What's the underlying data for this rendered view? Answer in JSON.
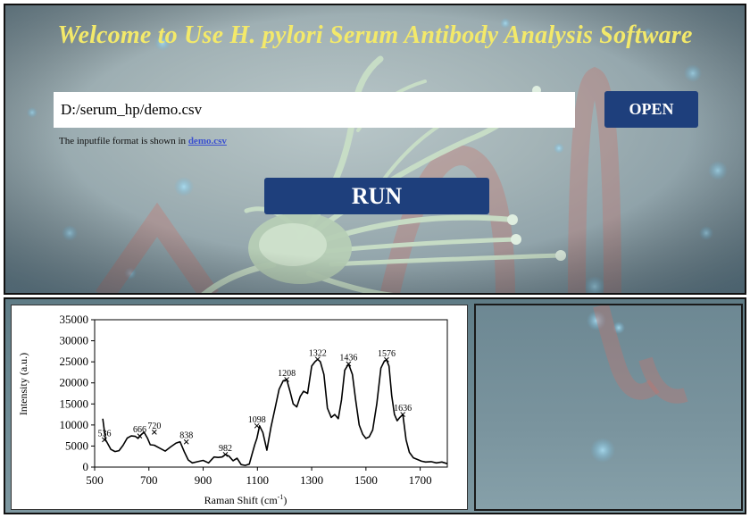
{
  "app": {
    "title": "Welcome to Use H. pylori Serum Antibody Analysis Software",
    "file_path": "D:/serum_hp/demo.csv",
    "open_label": "OPEN",
    "hint_text": "The inputfile format is shown in ",
    "hint_link": "demo.csv",
    "run_label": "RUN"
  },
  "colors": {
    "title": "#f3e96a",
    "button_bg": "#1e3f7c",
    "button_text": "#ffffff",
    "link": "#3a4fd0"
  },
  "chart_data": {
    "type": "line",
    "title": "",
    "xlabel": "Raman Shift (cm",
    "xlabel_sup": "-1",
    "xlabel_end": ")",
    "ylabel": "Intensity (a.u.)",
    "xlim": [
      500,
      1800
    ],
    "ylim": [
      0,
      35000
    ],
    "xticks": [
      500,
      700,
      900,
      1100,
      1300,
      1500,
      1700
    ],
    "yticks": [
      0,
      5000,
      10000,
      15000,
      20000,
      25000,
      30000,
      35000
    ],
    "series": [
      {
        "x": [
          530,
          540,
          548,
          560,
          575,
          590,
          605,
          620,
          635,
          650,
          660,
          670,
          682,
          695,
          705,
          720,
          740,
          760,
          780,
          800,
          815,
          830,
          845,
          860,
          880,
          900,
          920,
          940,
          955,
          970,
          982,
          995,
          1010,
          1025,
          1040,
          1055,
          1070,
          1080,
          1090,
          1098,
          1108,
          1120,
          1135,
          1150,
          1165,
          1180,
          1195,
          1208,
          1220,
          1232,
          1245,
          1258,
          1270,
          1285,
          1300,
          1312,
          1322,
          1332,
          1345,
          1358,
          1372,
          1385,
          1398,
          1410,
          1422,
          1436,
          1450,
          1462,
          1475,
          1488,
          1500,
          1512,
          1525,
          1540,
          1555,
          1568,
          1576,
          1585,
          1595,
          1605,
          1615,
          1625,
          1636,
          1648,
          1660,
          1675,
          1690,
          1705,
          1720,
          1740,
          1760,
          1780,
          1800
        ],
        "y": [
          11500,
          6500,
          5600,
          4200,
          3700,
          3900,
          5200,
          6900,
          7400,
          7300,
          6800,
          7600,
          8300,
          6800,
          5300,
          5200,
          4500,
          3800,
          4800,
          5700,
          6000,
          3700,
          1700,
          1000,
          1300,
          1600,
          1000,
          2400,
          2300,
          2400,
          3000,
          2600,
          1500,
          2100,
          600,
          400,
          700,
          3000,
          5300,
          6800,
          9800,
          8200,
          4000,
          9500,
          14000,
          18500,
          20500,
          20800,
          18000,
          15000,
          14300,
          16800,
          18000,
          17500,
          24000,
          25000,
          25600,
          25000,
          22000,
          14000,
          11800,
          12500,
          11500,
          16000,
          23000,
          24500,
          22000,
          16000,
          10000,
          7800,
          6800,
          7200,
          8800,
          15000,
          23500,
          25200,
          25500,
          24000,
          17000,
          12500,
          11000,
          11800,
          12500,
          6500,
          3500,
          2200,
          1800,
          1400,
          1200,
          1300,
          1000,
          1200,
          800
        ]
      }
    ],
    "peak_labels": [
      {
        "x": 536,
        "y": 6500,
        "label": "536"
      },
      {
        "x": 666,
        "y": 7400,
        "label": "666"
      },
      {
        "x": 720,
        "y": 8300,
        "label": "720"
      },
      {
        "x": 838,
        "y": 6000,
        "label": "838"
      },
      {
        "x": 982,
        "y": 3000,
        "label": "982"
      },
      {
        "x": 1098,
        "y": 9800,
        "label": "1098"
      },
      {
        "x": 1208,
        "y": 20800,
        "label": "1208"
      },
      {
        "x": 1322,
        "y": 25600,
        "label": "1322"
      },
      {
        "x": 1436,
        "y": 24500,
        "label": "1436"
      },
      {
        "x": 1576,
        "y": 25500,
        "label": "1576"
      },
      {
        "x": 1636,
        "y": 12500,
        "label": "1636"
      }
    ]
  }
}
